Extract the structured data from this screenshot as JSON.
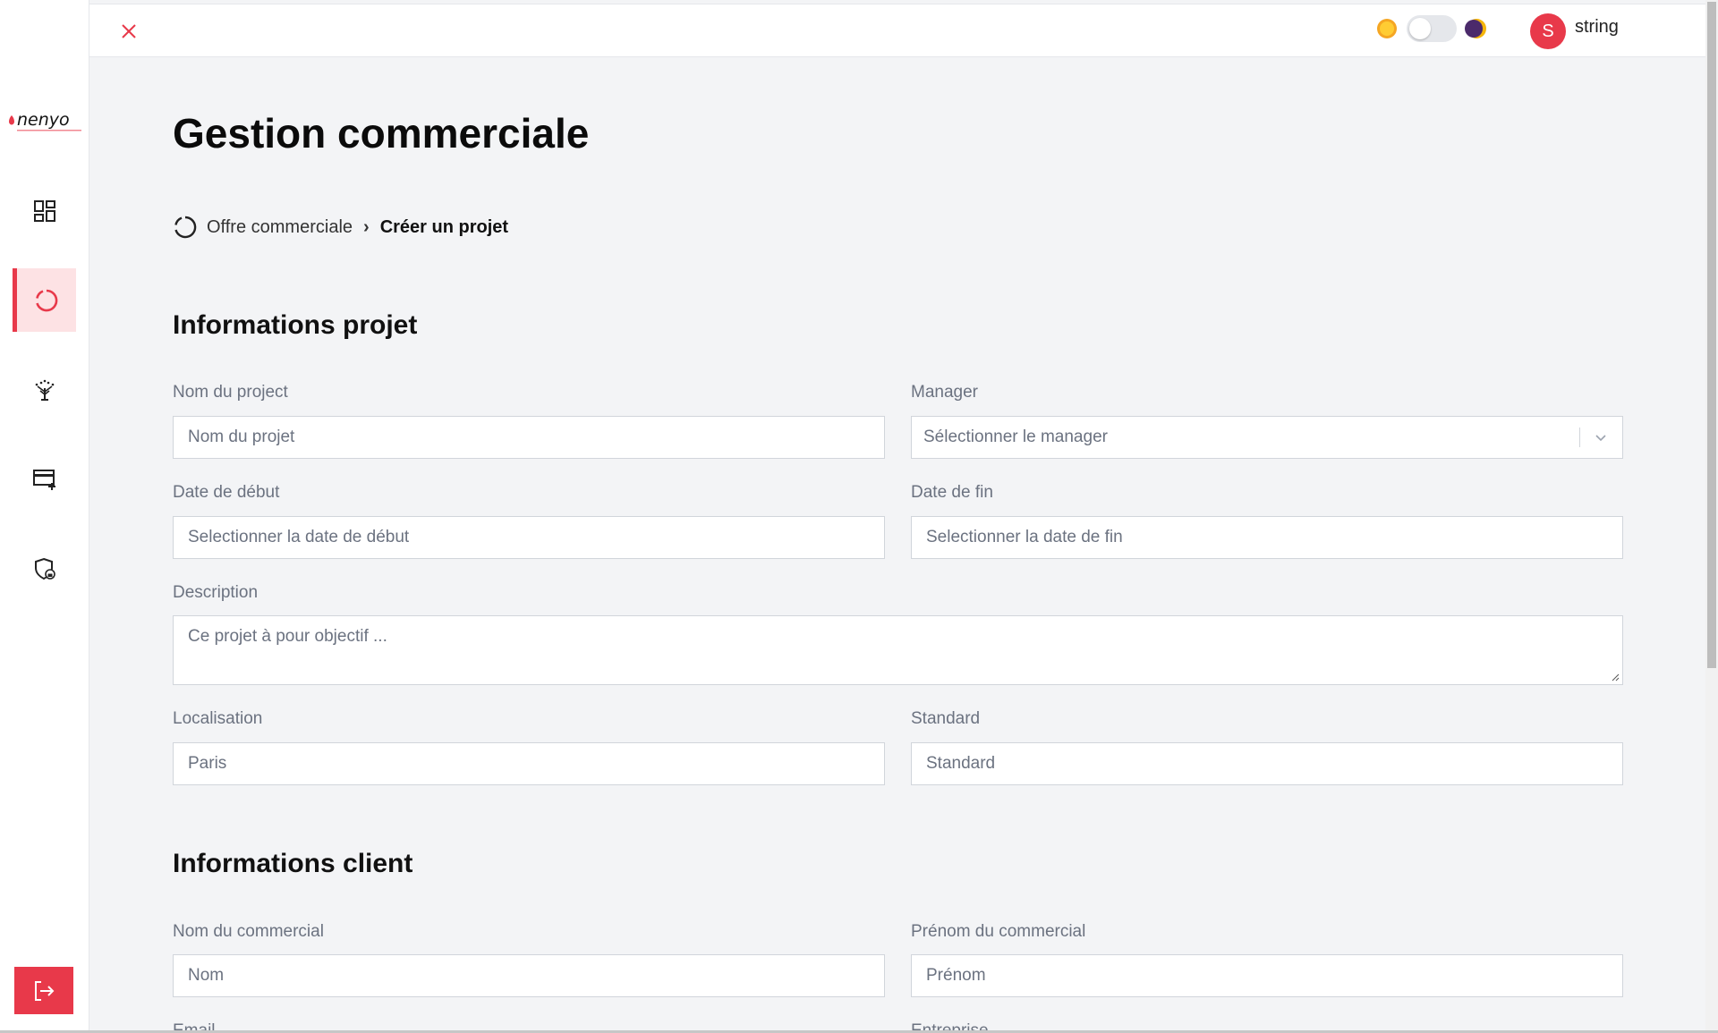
{
  "app": {
    "logo_text": "nenyo",
    "user": {
      "initial": "S",
      "name": "string"
    }
  },
  "page": {
    "title": "Gestion commerciale",
    "breadcrumb": {
      "parent": "Offre commerciale",
      "separator": "›",
      "current": "Créer un projet"
    }
  },
  "sections": {
    "project": {
      "title": "Informations projet",
      "fields": {
        "name": {
          "label": "Nom du project",
          "placeholder": "Nom du projet"
        },
        "manager": {
          "label": "Manager",
          "placeholder": "Sélectionner le manager"
        },
        "start_date": {
          "label": "Date de début",
          "placeholder": "Selectionner la date de début"
        },
        "end_date": {
          "label": "Date de fin",
          "placeholder": "Selectionner la date de fin"
        },
        "description": {
          "label": "Description",
          "placeholder": "Ce projet à pour objectif ..."
        },
        "location": {
          "label": "Localisation",
          "placeholder": "Paris"
        },
        "standard": {
          "label": "Standard",
          "placeholder": "Standard"
        }
      }
    },
    "client": {
      "title": "Informations client",
      "fields": {
        "last_name": {
          "label": "Nom du commercial",
          "placeholder": "Nom"
        },
        "first_name": {
          "label": "Prénom du commercial",
          "placeholder": "Prénom"
        },
        "email": {
          "label": "Email"
        },
        "company": {
          "label": "Entreprise"
        }
      }
    }
  },
  "colors": {
    "accent": "#e8394a",
    "active_bg": "#fde2e4",
    "page_bg": "#f3f4f6"
  },
  "icons": {
    "sidebar": [
      "dashboard-icon",
      "commercial-offer-icon",
      "tree-icon",
      "card-add-icon",
      "shield-lock-icon"
    ],
    "logout": "logout-icon",
    "close": "close-icon",
    "theme": [
      "sun-icon",
      "moon-icon"
    ]
  }
}
